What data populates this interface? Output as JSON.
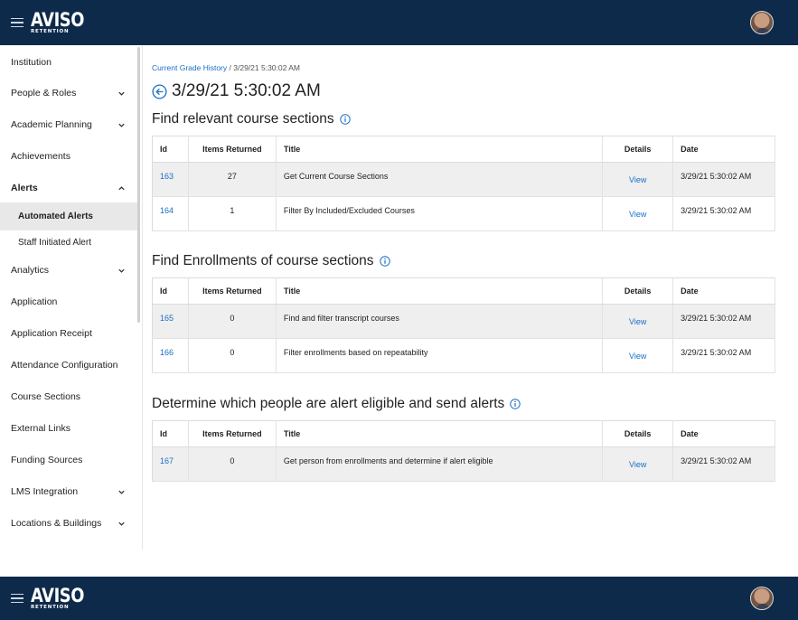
{
  "header": {
    "logo_main": "AVISO",
    "logo_sub": "RETENTION",
    "menu_icon": "hamburger-icon",
    "avatar_icon": "user-avatar"
  },
  "sidebar": {
    "items": [
      {
        "label": "Institution",
        "chevron": ""
      },
      {
        "label": "People & Roles",
        "chevron": "down"
      },
      {
        "label": "Academic Planning",
        "chevron": "down"
      },
      {
        "label": "Achievements",
        "chevron": ""
      },
      {
        "label": "Alerts",
        "chevron": "up"
      },
      {
        "label": "Automated Alerts",
        "chevron": ""
      },
      {
        "label": "Staff Initiated Alert",
        "chevron": ""
      },
      {
        "label": "Analytics",
        "chevron": "down"
      },
      {
        "label": "Application",
        "chevron": ""
      },
      {
        "label": "Application Receipt",
        "chevron": ""
      },
      {
        "label": "Attendance Configuration",
        "chevron": ""
      },
      {
        "label": "Course Sections",
        "chevron": ""
      },
      {
        "label": "External Links",
        "chevron": ""
      },
      {
        "label": "Funding Sources",
        "chevron": ""
      },
      {
        "label": "LMS Integration",
        "chevron": "down"
      },
      {
        "label": "Locations & Buildings",
        "chevron": "down"
      }
    ]
  },
  "breadcrumb": {
    "link": "Current Grade History",
    "separator": "/",
    "current": "3/29/21 5:30:02 AM"
  },
  "page_title": "3/29/21 5:30:02 AM",
  "table_headers": {
    "id": "Id",
    "items": "Items Returned",
    "title": "Title",
    "details": "Details",
    "date": "Date"
  },
  "sections": [
    {
      "title": "Find relevant course sections",
      "rows": [
        {
          "id": "163",
          "items": "27",
          "title": "Get Current Course Sections",
          "details": "View",
          "date": "3/29/21 5:30:02 AM"
        },
        {
          "id": "164",
          "items": "1",
          "title": "Filter By Included/Excluded Courses",
          "details": "View",
          "date": "3/29/21 5:30:02 AM"
        }
      ]
    },
    {
      "title": "Find Enrollments of course sections",
      "rows": [
        {
          "id": "165",
          "items": "0",
          "title": "Find and filter transcript courses",
          "details": "View",
          "date": "3/29/21 5:30:02 AM"
        },
        {
          "id": "166",
          "items": "0",
          "title": "Filter enrollments based on repeatability",
          "details": "View",
          "date": "3/29/21 5:30:02 AM"
        }
      ]
    },
    {
      "title": "Determine which people are alert eligible and send alerts",
      "rows": [
        {
          "id": "167",
          "items": "0",
          "title": "Get person from enrollments and determine if alert eligible",
          "details": "View",
          "date": "3/29/21 5:30:02 AM"
        }
      ]
    }
  ],
  "colors": {
    "header_bg": "#0d2a4a",
    "link": "#1a6fc4",
    "row_shade": "#efefef"
  }
}
